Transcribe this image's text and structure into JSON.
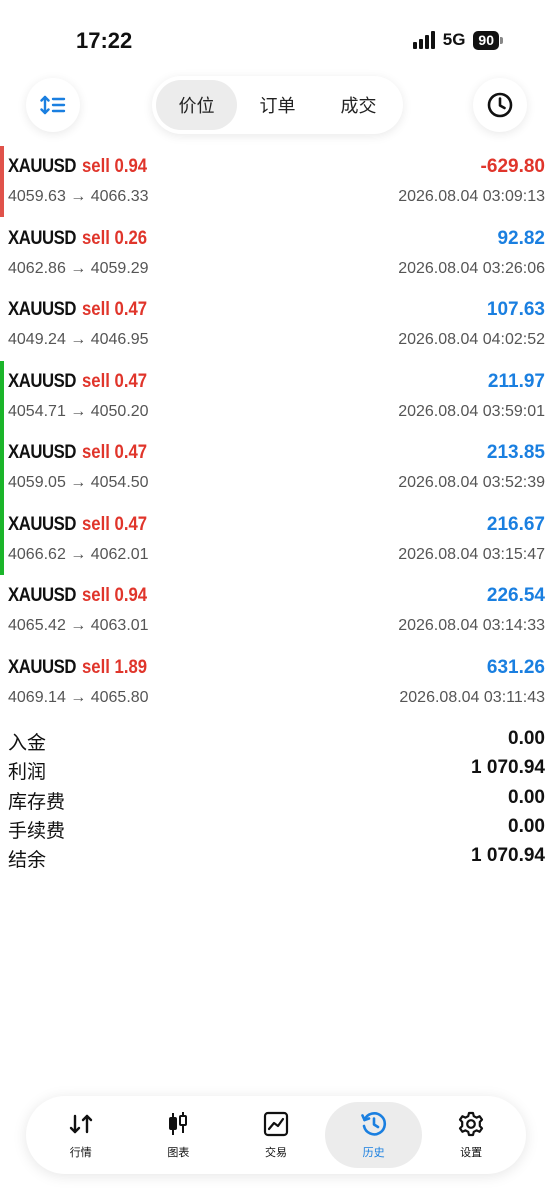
{
  "status": {
    "time": "17:22",
    "network": "5G",
    "battery": "90"
  },
  "toolbar": {
    "tabs": [
      {
        "label": "价位",
        "active": true
      },
      {
        "label": "订单",
        "active": false
      },
      {
        "label": "成交",
        "active": false
      }
    ]
  },
  "trades": [
    {
      "symbol": "XAUUSD",
      "side": "sell 0.94",
      "prices": "4059.63 → 4066.33",
      "profit": "-629.80",
      "time": "2026.08.04 03:09:13"
    },
    {
      "symbol": "XAUUSD",
      "side": "sell 0.26",
      "prices": "4062.86 → 4059.29",
      "profit": "92.82",
      "time": "2026.08.04 03:26:06"
    },
    {
      "symbol": "XAUUSD",
      "side": "sell 0.47",
      "prices": "4049.24 → 4046.95",
      "profit": "107.63",
      "time": "2026.08.04 04:02:52"
    },
    {
      "symbol": "XAUUSD",
      "side": "sell 0.47",
      "prices": "4054.71 → 4050.20",
      "profit": "211.97",
      "time": "2026.08.04 03:59:01"
    },
    {
      "symbol": "XAUUSD",
      "side": "sell 0.47",
      "prices": "4059.05 → 4054.50",
      "profit": "213.85",
      "time": "2026.08.04 03:52:39"
    },
    {
      "symbol": "XAUUSD",
      "side": "sell 0.47",
      "prices": "4066.62 → 4062.01",
      "profit": "216.67",
      "time": "2026.08.04 03:15:47"
    },
    {
      "symbol": "XAUUSD",
      "side": "sell 0.94",
      "prices": "4065.42 → 4063.01",
      "profit": "226.54",
      "time": "2026.08.04 03:14:33"
    },
    {
      "symbol": "XAUUSD",
      "side": "sell 1.89",
      "prices": "4069.14 → 4065.80",
      "profit": "631.26",
      "time": "2026.08.04 03:11:43"
    }
  ],
  "summary": [
    {
      "label": "入金",
      "value": "0.00"
    },
    {
      "label": "利润",
      "value": "1 070.94"
    },
    {
      "label": "库存费",
      "value": "0.00"
    },
    {
      "label": "手续费",
      "value": "0.00"
    },
    {
      "label": "结余",
      "value": "1 070.94"
    }
  ],
  "nav": [
    {
      "label": "行情",
      "icon": "quotes-arrows-icon",
      "active": false
    },
    {
      "label": "图表",
      "icon": "candlestick-chart-icon",
      "active": false
    },
    {
      "label": "交易",
      "icon": "trade-chart-icon",
      "active": false
    },
    {
      "label": "历史",
      "icon": "history-clock-icon",
      "active": true
    },
    {
      "label": "设置",
      "icon": "gear-icon",
      "active": false
    }
  ],
  "colors": {
    "sell": "#e0352b",
    "positive": "#1a7fe0",
    "negative": "#e0352b",
    "accent": "#1a7fe0"
  }
}
